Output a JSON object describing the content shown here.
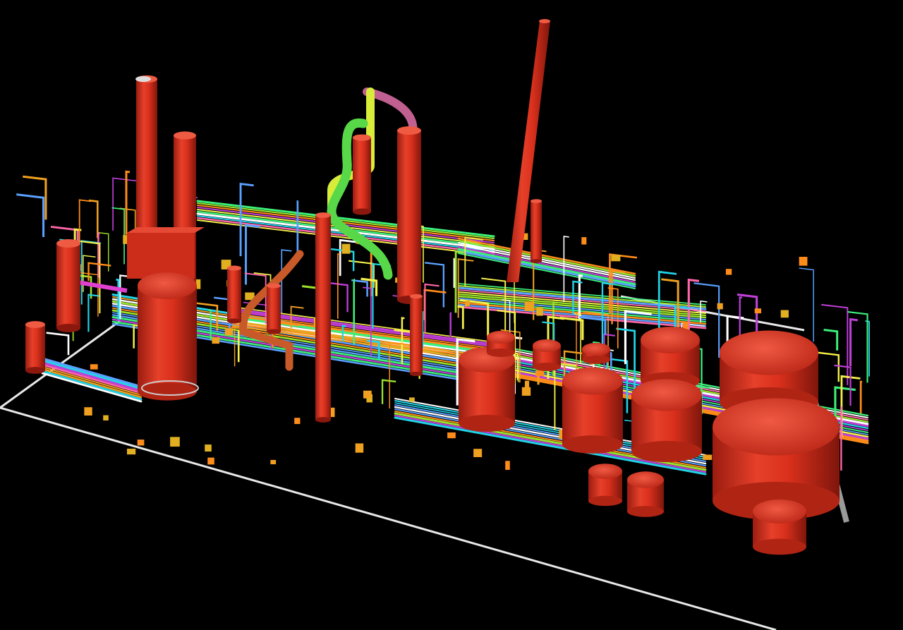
{
  "scene": {
    "background": "#000000",
    "colors": {
      "vessel": "#d9301c",
      "vessel_light": "#ee4a35",
      "vessel_dark": "#8f1a10",
      "boundary": "#e8e8e8",
      "pipes": [
        "#22d4e8",
        "#c03fd8",
        "#f0a020",
        "#9be22c",
        "#f5f04a",
        "#ff66aa",
        "#5aa0ff",
        "#ffffff",
        "#ff8c1a",
        "#3cf07a"
      ]
    },
    "equipment": {
      "columns": [
        "stack-left",
        "stack-left-2",
        "column-center",
        "column-center-2",
        "column-center-3",
        "tall-stack-right",
        "column-right-2"
      ],
      "tanks": [
        "tank-a",
        "tank-b",
        "tank-c",
        "tank-d",
        "tank-e",
        "tank-f",
        "tank-g",
        "tank-h",
        "tank-i",
        "tank-j",
        "tank-k",
        "tank-l",
        "tank-m"
      ]
    }
  }
}
